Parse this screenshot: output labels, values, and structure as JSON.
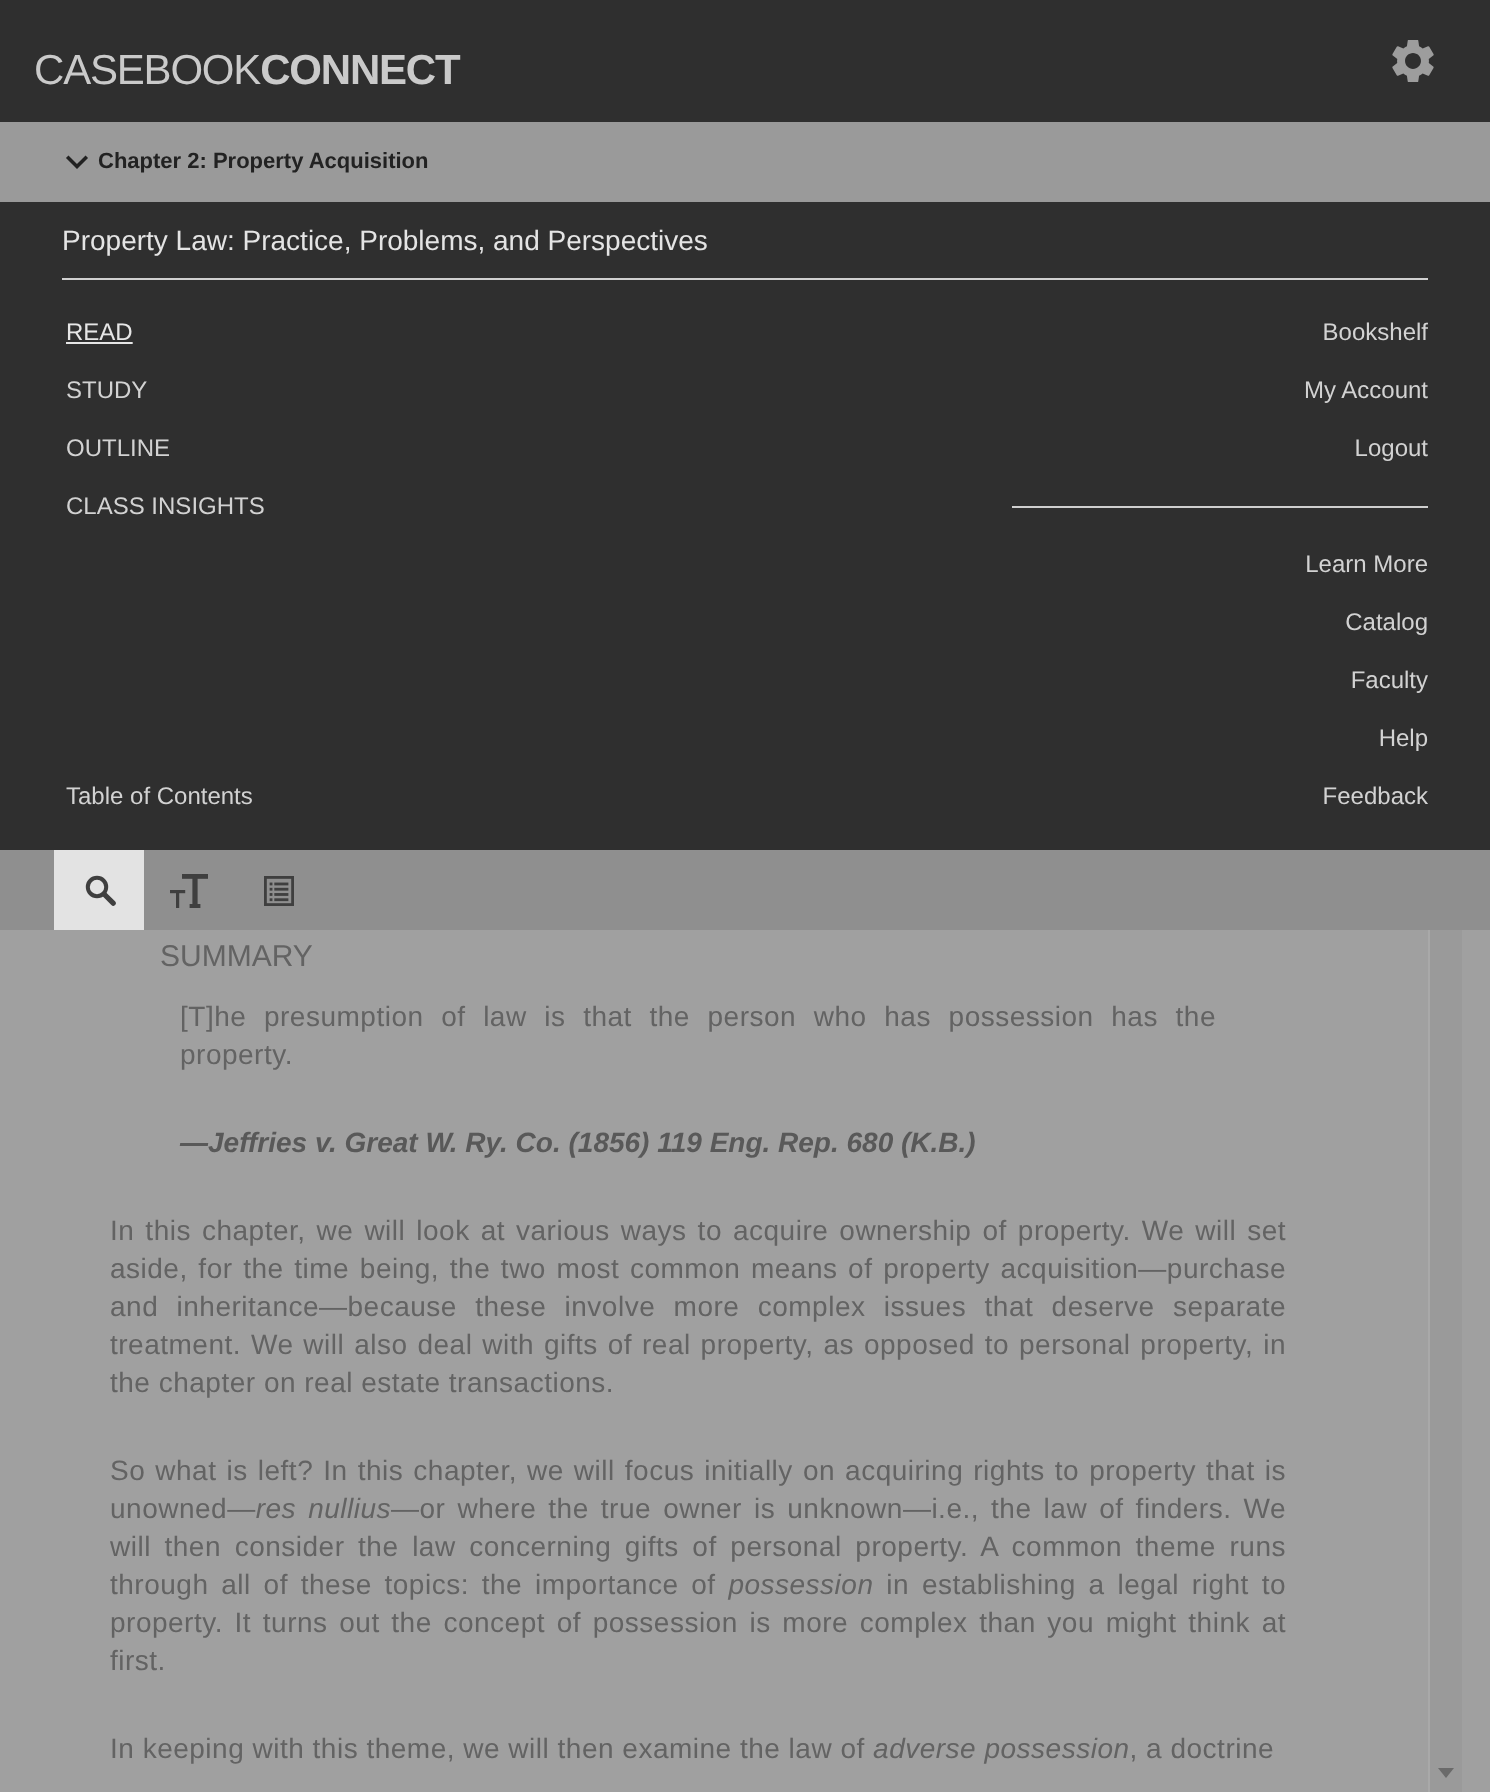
{
  "header": {
    "logo": "CASEBOOK**CONNECT**"
  },
  "chapter_bar": {
    "title": "Chapter 2: Property Acquisition",
    "expanded": true
  },
  "menu": {
    "open": true,
    "book_title": "Property Law: Practice, Problems, and Perspectives",
    "primary_nav": [
      {
        "label": "READ",
        "selected": true
      },
      {
        "label": "STUDY",
        "selected": false
      },
      {
        "label": "OUTLINE",
        "selected": false
      },
      {
        "label": "CLASS INSIGHTS",
        "selected": false
      }
    ],
    "table_of_contents": "Table of Contents",
    "account_links": [
      "Bookshelf",
      "My Account",
      "Logout"
    ],
    "info_links": [
      "Learn More",
      "Catalog",
      "Faculty",
      "Help",
      "Feedback"
    ]
  },
  "toolbar": {
    "tools": [
      {
        "kind": "search",
        "selected": true
      },
      {
        "kind": "text-size",
        "selected": false
      },
      {
        "kind": "contents",
        "selected": false
      }
    ]
  },
  "content": {
    "heading": "SUMMARY",
    "epigraph": "[T]he presumption of law is that the person who has possession has the property.",
    "citation": "—Jeffries v. Great W. Ry. Co. (1856) 119 Eng. Rep. 680 (K.B.)",
    "paragraphs": [
      "In this chapter, we will look at various ways to acquire ownership of property. We will set aside, for the time being, the two most common means of property acquisition—purchase and inheritance—because these involve more complex issues that deserve separate treatment. We will also deal with gifts of real property, as opposed to personal property, in the chapter on real estate transactions.",
      "So what is left? In this chapter, we will focus initially on acquiring rights to property that is unowned—*res nullius*—or where the true owner is unknown—i.e., the law of finders. We will then consider the law concerning gifts of personal property. A common theme runs through all of these topics: the importance of *possession* in establishing a legal right to property. It turns out the concept of possession is more complex than you might think at first.",
      "In keeping with this theme, we will then examine the law of *adverse possession*, a doctrine"
    ]
  }
}
